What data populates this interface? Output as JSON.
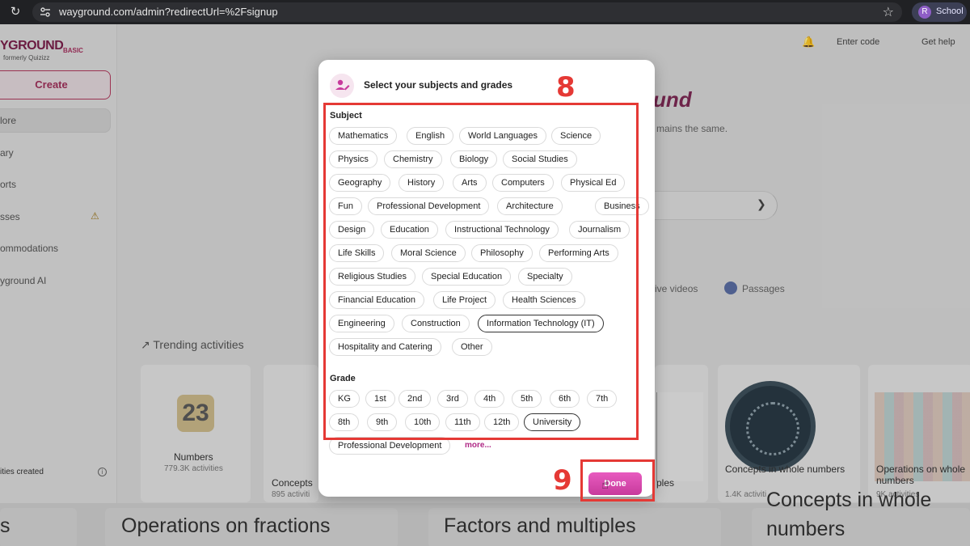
{
  "browser": {
    "url": "wayground.com/admin?redirectUrl=%2Fsignup",
    "profile_initial": "R",
    "profile_label": "School"
  },
  "sidebar": {
    "logo_text": "YGROUND",
    "logo_badge": "BASIC",
    "logo_sub": "formerly Quizizz",
    "create_label": "Create",
    "items": [
      "lore",
      "ary",
      "orts",
      "sses",
      "ommodations",
      "yground AI"
    ],
    "activities_created": "ities created"
  },
  "header": {
    "enter_code": "Enter code",
    "get_help": "Get help"
  },
  "hero": {
    "title": "und",
    "subtitle": "mains the same.",
    "tab_videos": "ive videos",
    "tab_passages": "Passages"
  },
  "trending": {
    "title": "Trending activities",
    "cards": [
      {
        "name": "Numbers",
        "count": "779.3K activities"
      },
      {
        "name": "Concepts",
        "count": "895 activiti"
      },
      {
        "name": "ples",
        "count": ""
      },
      {
        "name": "Concepts in whole numbers",
        "count": "1.4K activiti"
      },
      {
        "name": "Operations on whole numbers",
        "count": "9K activities"
      }
    ]
  },
  "bottom_cards": [
    {
      "title": "s"
    },
    {
      "title": "Operations on fractions"
    },
    {
      "title": "Factors and multiples"
    },
    {
      "title": "Concepts in whole numbers"
    }
  ],
  "modal": {
    "title": "Select your subjects and grades",
    "subject_label": "Subject",
    "subjects": [
      "Mathematics",
      "English",
      "World Languages",
      "Science",
      "Physics",
      "Chemistry",
      "Biology",
      "Social Studies",
      "Geography",
      "History",
      "Arts",
      "Computers",
      "Physical Ed",
      "Fun",
      "Professional Development",
      "Architecture",
      "Business",
      "Design",
      "Education",
      "Instructional Technology",
      "Journalism",
      "Life Skills",
      "Moral Science",
      "Philosophy",
      "Performing Arts",
      "Religious Studies",
      "Special Education",
      "Specialty",
      "Financial Education",
      "Life Project",
      "Health Sciences",
      "Engineering",
      "Construction",
      "Information Technology (IT)",
      "Hospitality and Catering",
      "Other"
    ],
    "selected_subject": "Information Technology (IT)",
    "grade_label": "Grade",
    "grades": [
      "KG",
      "1st",
      "2nd",
      "3rd",
      "4th",
      "5th",
      "6th",
      "7th",
      "8th",
      "9th",
      "10th",
      "11th",
      "12th",
      "University",
      "Professional Development"
    ],
    "selected_grade": "University",
    "more_label": "more...",
    "done_label": "Done"
  },
  "annotations": {
    "step_8": "8",
    "step_9": "9",
    "color": "#e53935"
  },
  "colors": {
    "accent": "#c73a9c",
    "brand": "#7a1f4a"
  }
}
